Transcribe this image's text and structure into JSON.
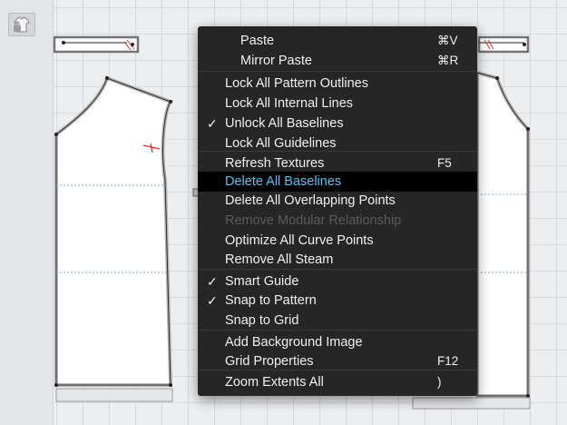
{
  "toolbar": {
    "lock_tool_icon": "lock-shirt-icon"
  },
  "context_menu": {
    "items": [
      {
        "label": "Paste",
        "shortcut": "⌘V",
        "checked": false,
        "state": "normal",
        "indent": true
      },
      {
        "label": "Mirror Paste",
        "shortcut": "⌘R",
        "checked": false,
        "state": "normal",
        "indent": true
      },
      {
        "label": "Lock All Pattern Outlines",
        "shortcut": "",
        "checked": false,
        "state": "normal"
      },
      {
        "label": "Lock All Internal Lines",
        "shortcut": "",
        "checked": false,
        "state": "normal"
      },
      {
        "label": "Unlock All Baselines",
        "shortcut": "",
        "checked": true,
        "state": "normal"
      },
      {
        "label": "Lock All Guidelines",
        "shortcut": "",
        "checked": false,
        "state": "normal"
      },
      {
        "label": "Refresh Textures",
        "shortcut": "F5",
        "checked": false,
        "state": "normal"
      },
      {
        "label": "Delete All Baselines",
        "shortcut": "",
        "checked": false,
        "state": "highlighted"
      },
      {
        "label": "Delete All Overlapping Points",
        "shortcut": "",
        "checked": false,
        "state": "normal"
      },
      {
        "label": "Remove Modular Relationship",
        "shortcut": "",
        "checked": false,
        "state": "disabled"
      },
      {
        "label": "Optimize All Curve Points",
        "shortcut": "",
        "checked": false,
        "state": "normal"
      },
      {
        "label": "Remove All Steam",
        "shortcut": "",
        "checked": false,
        "state": "normal"
      },
      {
        "label": "Smart Guide",
        "shortcut": "",
        "checked": true,
        "state": "normal"
      },
      {
        "label": "Snap to Pattern",
        "shortcut": "",
        "checked": true,
        "state": "normal"
      },
      {
        "label": "Snap to Grid",
        "shortcut": "",
        "checked": false,
        "state": "normal"
      },
      {
        "label": "Add Background Image",
        "shortcut": "",
        "checked": false,
        "state": "normal"
      },
      {
        "label": "Grid Properties",
        "shortcut": "F12",
        "checked": false,
        "state": "normal"
      },
      {
        "label": "Zoom Extents All",
        "shortcut": ")",
        "checked": false,
        "state": "normal"
      }
    ],
    "check_glyph": "✓"
  }
}
